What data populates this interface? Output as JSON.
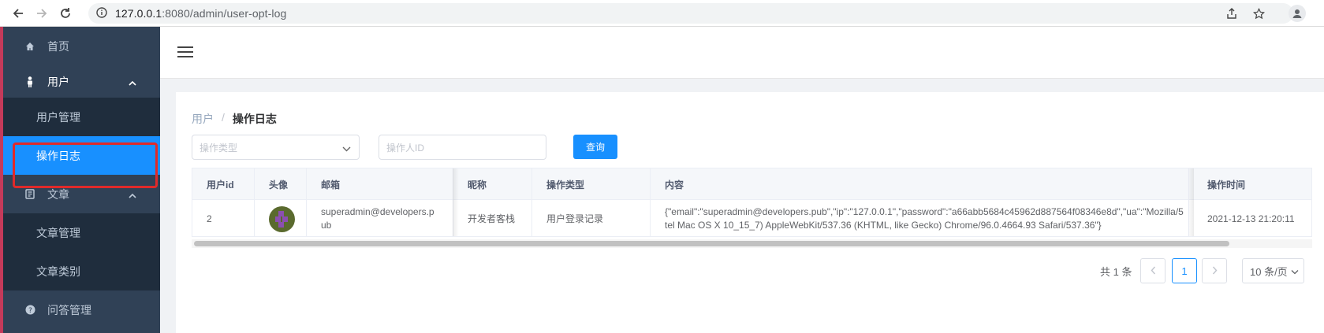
{
  "browser": {
    "url_host": "127.0.0.1",
    "url_rest": ":8080/admin/user-opt-log"
  },
  "sidebar": {
    "items": [
      {
        "label": "首页",
        "icon": "home-icon"
      },
      {
        "label": "用户",
        "icon": "user-icon"
      },
      {
        "label": "用户管理"
      },
      {
        "label": "操作日志"
      },
      {
        "label": "文章",
        "icon": "document-icon"
      },
      {
        "label": "文章管理"
      },
      {
        "label": "文章类别"
      },
      {
        "label": "问答管理",
        "icon": "question-icon"
      }
    ]
  },
  "breadcrumb": {
    "parent": "用户",
    "separator": "/",
    "current": "操作日志"
  },
  "filters": {
    "type_placeholder": "操作类型",
    "operator_placeholder": "操作人ID",
    "query_label": "查询"
  },
  "table": {
    "headers": [
      "用户id",
      "头像",
      "邮箱",
      "昵称",
      "操作类型",
      "内容",
      "操作时间"
    ],
    "rows": [
      {
        "user_id": "2",
        "email_line1": "superadmin@developers.p",
        "email_line2": "ub",
        "nickname": "开发者客栈",
        "op_type": "用户登录记录",
        "content_line1": "{\"email\":\"superadmin@developers.pub\",\"ip\":\"127.0.0.1\",\"password\":\"a66abb5684c45962d887564f08346e8d\",\"ua\":\"Mozilla/5",
        "content_line2": "tel Mac OS X 10_15_7) AppleWebKit/537.36 (KHTML, like Gecko) Chrome/96.0.4664.93 Safari/537.36\"}",
        "time": "2021-12-13 21:20:11"
      }
    ]
  },
  "pagination": {
    "total": "共 1 条",
    "prev": "<",
    "current_page": "1",
    "next": ">",
    "page_size": "10 条/页"
  },
  "colors": {
    "sidebar_bg": "#304156",
    "submenu_bg": "#1f2d3d",
    "active_item": "#1890ff",
    "primary": "#1890ff"
  }
}
